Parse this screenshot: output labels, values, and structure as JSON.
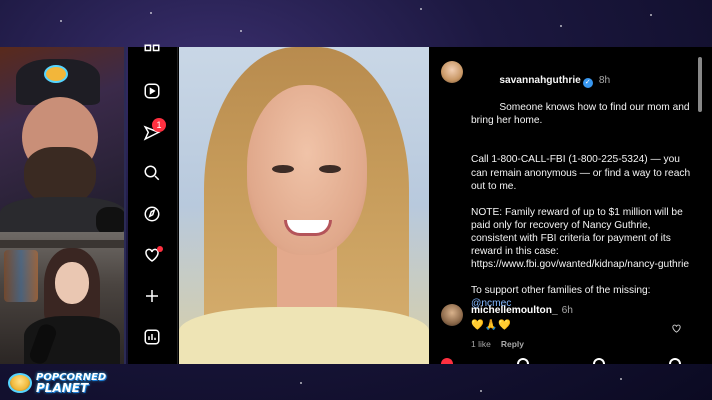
{
  "stream": {
    "logo_line1": "POPCORNED",
    "logo_line2": "PLANET"
  },
  "sidebar": {
    "items": [
      {
        "icon": "grid-icon"
      },
      {
        "icon": "reels-icon"
      },
      {
        "icon": "messages-icon",
        "badge": "1"
      },
      {
        "icon": "search-icon"
      },
      {
        "icon": "explore-compass-icon"
      },
      {
        "icon": "notifications-heart-icon",
        "dot": true
      },
      {
        "icon": "create-plus-icon"
      },
      {
        "icon": "dashboard-icon"
      }
    ]
  },
  "post": {
    "username": "savannahguthrie",
    "time": "8h",
    "paragraphs": [
      "Someone knows how to find our mom and bring her home.",
      "Call 1-800-CALL-FBI (1-800-225-5324) — you can remain anonymous — or find a way to reach out to me.",
      "NOTE: Family reward of up to $1 million will be paid only for recovery of Nancy Guthrie, consistent with FBI criteria for payment of its reward in this case: https://www.fbi.gov/wanted/kidnap/nancy-guthrie",
      "To support other families of the missing:"
    ],
    "mention": "@ncmec"
  },
  "comment": {
    "username": "michellemoulton_",
    "time": "6h",
    "emojis": "💛🙏💛",
    "likes": "1 like",
    "reply": "Reply"
  },
  "colors": {
    "badge": "#ff3040",
    "verified": "#3897f0",
    "mention": "#82b7ff"
  }
}
